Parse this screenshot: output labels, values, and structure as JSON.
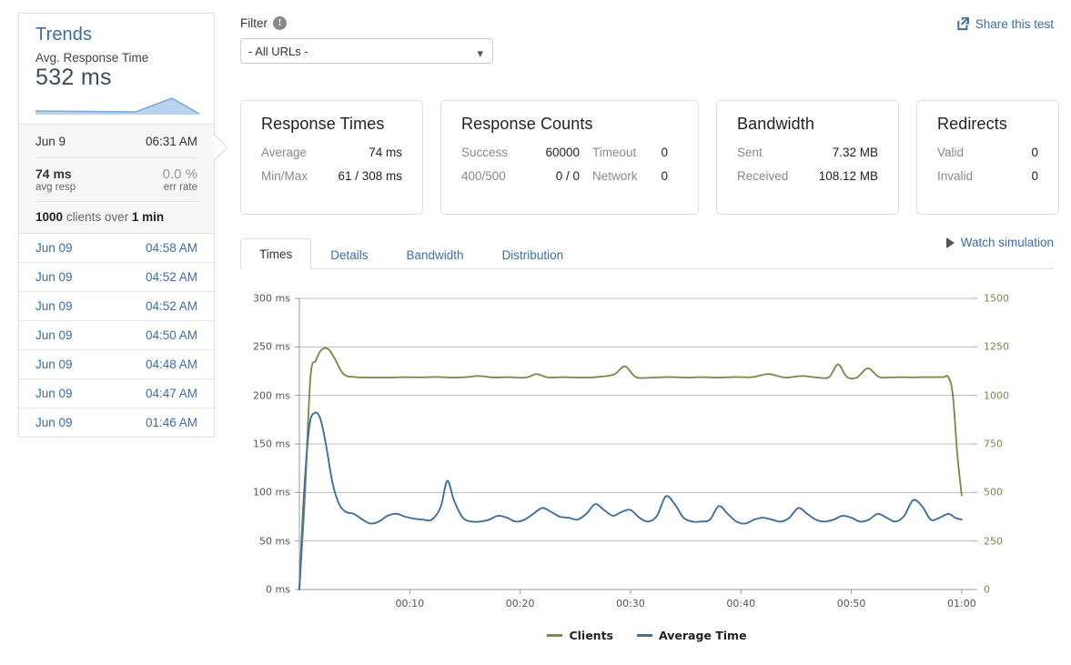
{
  "sidebar": {
    "trends": {
      "title": "Trends",
      "subtitle": "Avg. Response Time",
      "value": "532 ms",
      "sparkline_color": "#8ab4dd",
      "sparkline_points": [
        12,
        12.5,
        13,
        13.5,
        14,
        14.5,
        15,
        15.5,
        16,
        5,
        26
      ]
    },
    "selected": {
      "date": "Jun 9",
      "time": "06:31 AM",
      "avg_resp_value": "74 ms",
      "avg_resp_label": "avg resp",
      "err_rate_value": "0.0 %",
      "err_rate_label": "err rate",
      "clients_count": "1000",
      "clients_mid": "clients over",
      "clients_duration": "1 min"
    },
    "history": [
      {
        "date": "Jun 09",
        "time": "04:58 AM"
      },
      {
        "date": "Jun 09",
        "time": "04:52 AM"
      },
      {
        "date": "Jun 09",
        "time": "04:52 AM"
      },
      {
        "date": "Jun 09",
        "time": "04:50 AM"
      },
      {
        "date": "Jun 09",
        "time": "04:48 AM"
      },
      {
        "date": "Jun 09",
        "time": "04:47 AM"
      },
      {
        "date": "Jun 09",
        "time": "01:46 AM"
      }
    ]
  },
  "header": {
    "filter_label": "Filter",
    "info_icon": "info-icon",
    "filter_selected": "- All URLs -",
    "filter_options": [
      "- All URLs -"
    ],
    "share_label": "Share this test",
    "share_icon": "share-external-icon"
  },
  "cards": [
    {
      "title": "Response Times",
      "rows": [
        {
          "key": "Average",
          "value": "74 ms"
        },
        {
          "key": "Min/Max",
          "value": "61 / 308 ms"
        }
      ]
    },
    {
      "title": "Response Counts",
      "rows": [
        {
          "key": "Success",
          "value": "60000",
          "key2": "Timeout",
          "value2": "0"
        },
        {
          "key": "400/500",
          "value": "0 / 0",
          "key2": "Network",
          "value2": "0"
        }
      ]
    },
    {
      "title": "Bandwidth",
      "rows": [
        {
          "key": "Sent",
          "value": "7.32 MB"
        },
        {
          "key": "Received",
          "value": "108.12 MB"
        }
      ]
    },
    {
      "title": "Redirects",
      "rows": [
        {
          "key": "Valid",
          "value": "0"
        },
        {
          "key": "Invalid",
          "value": "0"
        }
      ]
    }
  ],
  "tabs": [
    {
      "label": "Times",
      "active": true
    },
    {
      "label": "Details",
      "active": false
    },
    {
      "label": "Bandwidth",
      "active": false
    },
    {
      "label": "Distribution",
      "active": false
    }
  ],
  "watch_simulation": {
    "label": "Watch simulation",
    "icon": "play-icon"
  },
  "chart_data": {
    "type": "line",
    "title": "",
    "xlabel": "",
    "ylabel": "",
    "grid": true,
    "legend_position": "bottom",
    "x_ticks": [
      "00:10",
      "00:20",
      "00:30",
      "00:40",
      "00:50",
      "01:00"
    ],
    "x_tick_values": [
      10,
      20,
      30,
      40,
      50,
      60
    ],
    "xlim": [
      0,
      61
    ],
    "left_axis": {
      "ticks": [
        "0 ms",
        "50 ms",
        "100 ms",
        "150 ms",
        "200 ms",
        "250 ms",
        "300 ms"
      ],
      "tick_values": [
        0,
        50,
        100,
        150,
        200,
        250,
        300
      ],
      "ylim": [
        0,
        300
      ],
      "unit": "ms",
      "color": "#555555"
    },
    "right_axis": {
      "ticks": [
        "0",
        "250",
        "500",
        "750",
        "1000",
        "1250",
        "1500"
      ],
      "tick_values": [
        0,
        250,
        500,
        750,
        1000,
        1250,
        1500
      ],
      "ylim": [
        0,
        1500
      ],
      "color": "#7a8a4e"
    },
    "series": [
      {
        "name": "Clients",
        "color": "#7d8c4c",
        "axis": "right",
        "x": [
          0.0,
          0.5,
          1.0,
          1.5,
          2.0,
          2.6,
          3.2,
          4.0,
          5.0,
          6.5,
          8.0,
          9.5,
          11.0,
          12.5,
          13.8,
          15.0,
          16.3,
          17.5,
          19.0,
          20.5,
          21.5,
          22.5,
          24.0,
          25.5,
          27.0,
          28.5,
          29.5,
          30.5,
          32.0,
          33.5,
          35.0,
          36.5,
          38.0,
          39.5,
          41.0,
          42.5,
          44.0,
          45.5,
          47.0,
          48.0,
          48.8,
          49.6,
          50.5,
          51.5,
          52.5,
          53.5,
          54.5,
          55.5,
          56.5,
          57.5,
          58.3,
          58.8,
          59.2,
          59.6,
          60.0
        ],
        "values": [
          0,
          480,
          1090,
          1180,
          1235,
          1240,
          1190,
          1110,
          1095,
          1092,
          1092,
          1094,
          1093,
          1095,
          1092,
          1094,
          1100,
          1093,
          1094,
          1092,
          1110,
          1093,
          1094,
          1092,
          1095,
          1108,
          1150,
          1094,
          1092,
          1095,
          1092,
          1094,
          1092,
          1095,
          1094,
          1110,
          1092,
          1100,
          1092,
          1095,
          1160,
          1095,
          1092,
          1140,
          1095,
          1093,
          1094,
          1093,
          1094,
          1094,
          1094,
          1094,
          1000,
          700,
          485
        ]
      },
      {
        "name": "Average Time",
        "color": "#3f6f9f",
        "axis": "left",
        "x": [
          0.0,
          0.4,
          0.9,
          1.4,
          1.9,
          2.4,
          3.0,
          3.6,
          4.2,
          4.9,
          5.6,
          6.4,
          7.2,
          8.0,
          8.8,
          9.6,
          10.4,
          11.2,
          12.0,
          12.8,
          13.4,
          14.0,
          14.8,
          15.6,
          16.4,
          17.2,
          18.0,
          18.8,
          19.6,
          20.4,
          21.2,
          22.0,
          22.8,
          23.6,
          24.4,
          25.2,
          26.0,
          26.8,
          27.6,
          28.4,
          29.2,
          30.0,
          30.8,
          31.6,
          32.4,
          33.2,
          34.0,
          34.8,
          35.6,
          36.4,
          37.2,
          38.0,
          38.8,
          39.6,
          40.4,
          41.2,
          42.0,
          42.8,
          43.6,
          44.4,
          45.2,
          46.0,
          46.8,
          47.6,
          48.4,
          49.2,
          50.0,
          50.8,
          51.6,
          52.4,
          53.2,
          54.0,
          54.8,
          55.6,
          56.4,
          57.2,
          58.0,
          58.8,
          59.4,
          60.0
        ],
        "values": [
          0,
          95,
          168,
          182,
          176,
          150,
          110,
          88,
          80,
          78,
          73,
          68,
          70,
          76,
          78,
          75,
          73,
          72,
          72,
          85,
          112,
          92,
          74,
          70,
          70,
          72,
          76,
          74,
          70,
          72,
          78,
          84,
          80,
          75,
          74,
          72,
          78,
          88,
          82,
          76,
          80,
          82,
          74,
          70,
          76,
          96,
          88,
          74,
          70,
          70,
          72,
          86,
          78,
          70,
          68,
          72,
          74,
          72,
          70,
          74,
          84,
          78,
          72,
          70,
          72,
          76,
          74,
          70,
          72,
          78,
          74,
          70,
          76,
          92,
          86,
          72,
          74,
          78,
          74,
          72
        ]
      }
    ]
  },
  "legend": [
    {
      "label": "Clients",
      "color": "#7d8c4c"
    },
    {
      "label": "Average Time",
      "color": "#3f6f9f"
    }
  ]
}
